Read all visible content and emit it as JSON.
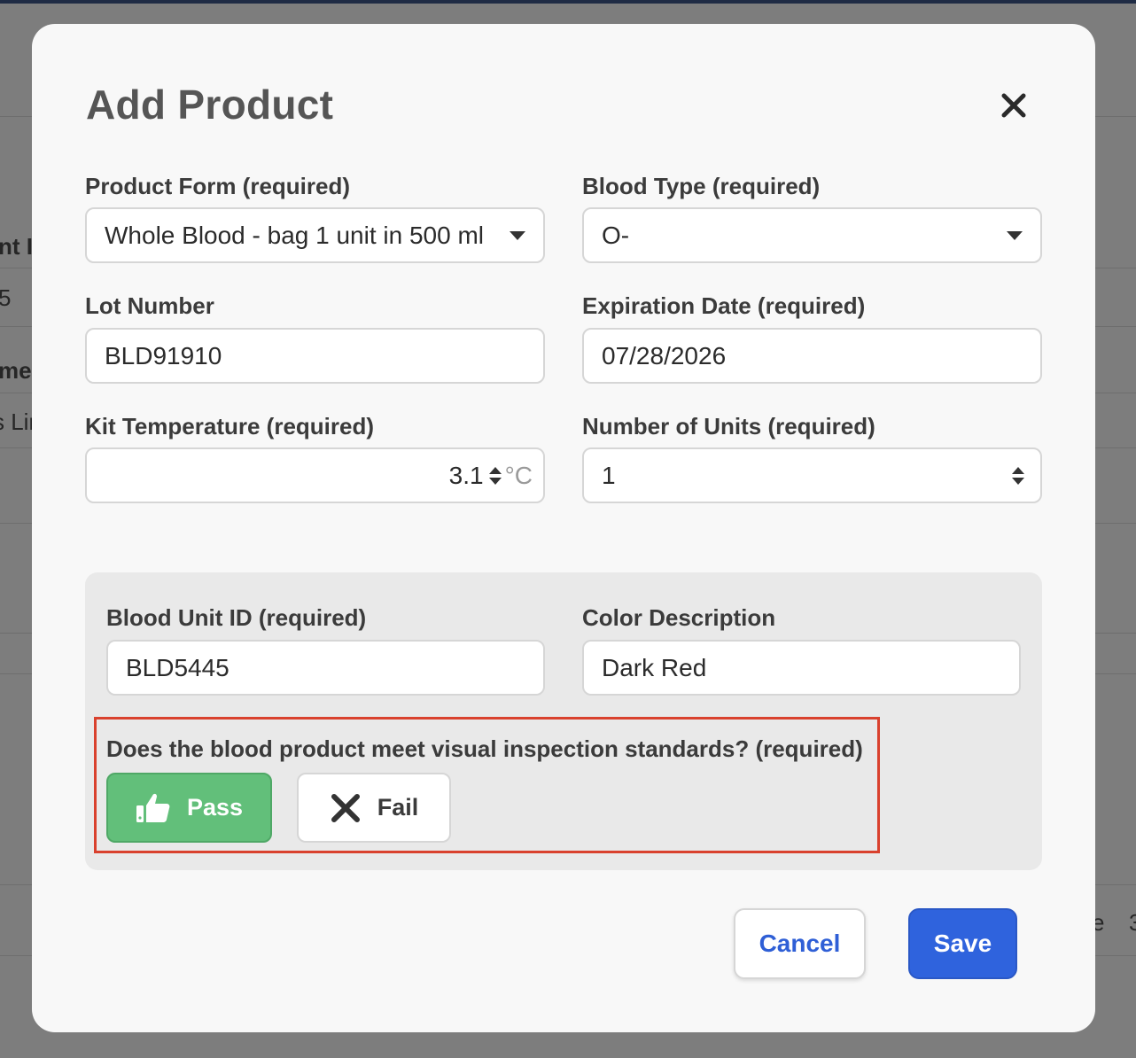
{
  "background": {
    "fragments": [
      "nt I",
      "5",
      "me",
      "s Lin",
      "e",
      "3"
    ]
  },
  "modal": {
    "title": "Add Product",
    "close_icon": "close-icon"
  },
  "form": {
    "product_form": {
      "label": "Product Form (required)",
      "value": "Whole Blood - bag 1 unit in 500 ml"
    },
    "blood_type": {
      "label": "Blood Type (required)",
      "value": "O-"
    },
    "lot_number": {
      "label": "Lot Number",
      "value": "BLD91910"
    },
    "expiration_date": {
      "label": "Expiration Date (required)",
      "value": "07/28/2026"
    },
    "kit_temperature": {
      "label": "Kit Temperature (required)",
      "value": "3.1",
      "unit": "°C"
    },
    "number_of_units": {
      "label": "Number of Units (required)",
      "value": "1"
    }
  },
  "inspection": {
    "blood_unit_id": {
      "label": "Blood Unit ID (required)",
      "value": "BLD5445"
    },
    "color_description": {
      "label": "Color Description",
      "value": "Dark Red"
    },
    "question": "Does the blood product meet visual inspection standards? (required)",
    "pass_label": "Pass",
    "fail_label": "Fail",
    "pass_icon": "thumbs-up-icon",
    "fail_icon": "x-icon",
    "pass_color": "#62bf7a",
    "highlight_color": "#d9412e"
  },
  "footer": {
    "cancel_label": "Cancel",
    "save_label": "Save",
    "save_color": "#2f63dd"
  }
}
